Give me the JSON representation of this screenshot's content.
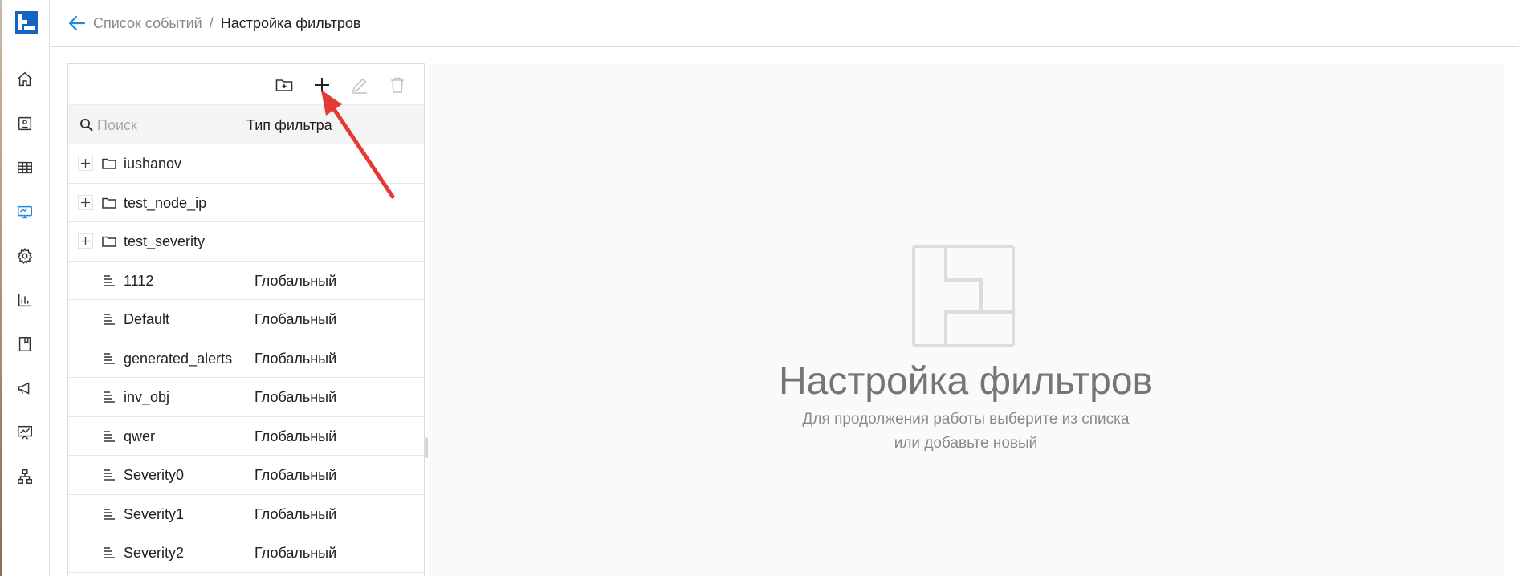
{
  "nav": {
    "items": [
      {
        "icon": "home-icon"
      },
      {
        "icon": "card-icon"
      },
      {
        "icon": "table-icon"
      },
      {
        "icon": "monitor-icon",
        "active": true
      },
      {
        "icon": "gear-icon"
      },
      {
        "icon": "bar-chart-icon"
      },
      {
        "icon": "book-icon"
      },
      {
        "icon": "megaphone-icon"
      },
      {
        "icon": "presentation-icon"
      },
      {
        "icon": "hierarchy-icon"
      }
    ],
    "accent": "#1e88e5"
  },
  "breadcrumb": {
    "parent": "Список событий",
    "separator": "/",
    "current": "Настройка фильтров"
  },
  "toolbar": {
    "buttons": [
      {
        "icon": "folder-plus-icon",
        "enabled": true
      },
      {
        "icon": "plus-icon",
        "enabled": true
      },
      {
        "icon": "pencil-icon",
        "enabled": false
      },
      {
        "icon": "trash-icon",
        "enabled": false
      }
    ]
  },
  "list": {
    "search_placeholder": "Поиск",
    "type_column": "Тип фильтра",
    "rows": [
      {
        "kind": "folder",
        "name": "iushanov",
        "type": ""
      },
      {
        "kind": "folder",
        "name": "test_node_ip",
        "type": ""
      },
      {
        "kind": "folder",
        "name": "test_severity",
        "type": ""
      },
      {
        "kind": "filter",
        "name": "1112",
        "type": "Глобальный"
      },
      {
        "kind": "filter",
        "name": "Default",
        "type": "Глобальный"
      },
      {
        "kind": "filter",
        "name": "generated_alerts",
        "type": "Глобальный"
      },
      {
        "kind": "filter",
        "name": "inv_obj",
        "type": "Глобальный"
      },
      {
        "kind": "filter",
        "name": "qwer",
        "type": "Глобальный"
      },
      {
        "kind": "filter",
        "name": "Severity0",
        "type": "Глобальный"
      },
      {
        "kind": "filter",
        "name": "Severity1",
        "type": "Глобальный"
      },
      {
        "kind": "filter",
        "name": "Severity2",
        "type": "Глобальный"
      }
    ]
  },
  "empty_state": {
    "title": "Настройка фильтров",
    "subtitle_line1": "Для продолжения работы выберите из списка",
    "subtitle_line2": "или добавьте новый"
  },
  "annotation": {
    "color": "#e53935",
    "points_to": "plus-icon"
  }
}
